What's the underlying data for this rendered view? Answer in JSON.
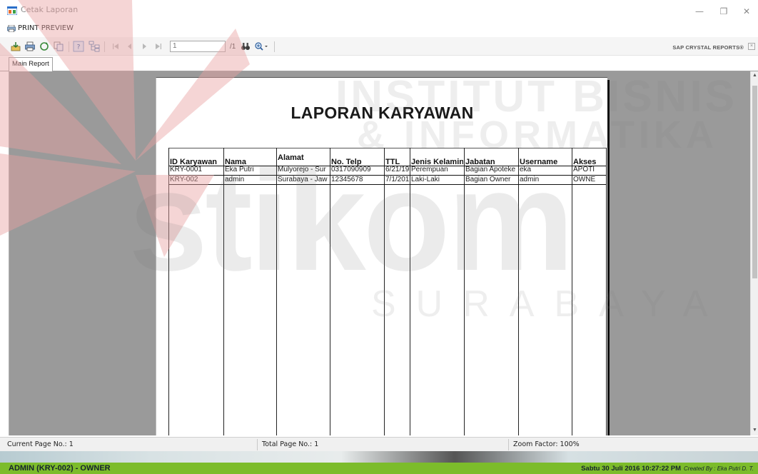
{
  "window": {
    "title": "Cetak Laporan",
    "minimize_glyph": "—",
    "maximize_glyph": "❐",
    "close_glyph": "✕"
  },
  "menu": {
    "print_preview_label": "PRINT PREVIEW"
  },
  "toolbar": {
    "page_input": "1",
    "page_total": "/1",
    "brand": "SAP CRYSTAL REPORTS®",
    "icons": [
      "export-icon",
      "print-icon",
      "refresh-icon",
      "copy-icon",
      "toggle-group-tree-icon",
      "group-tree-icon",
      "first-page-icon",
      "previous-page-icon",
      "next-page-icon",
      "last-page-icon",
      "find-icon",
      "zoom-icon"
    ]
  },
  "tabs": {
    "main_report": "Main Report"
  },
  "report": {
    "title": "LAPORAN KARYAWAN",
    "columns": [
      "ID Karyawan",
      "Nama",
      "Alamat",
      "No. Telp",
      "TTL",
      "Jenis Kelamin",
      "Jabatan",
      "Username",
      "Akses"
    ],
    "rows": [
      [
        "KRY-0001",
        "Eka Putri",
        "Mulyorejo - Sur",
        "0317090909",
        "6/21/19",
        "Perempuan",
        "Bagian Apoteke",
        "eka",
        "APOTI"
      ],
      [
        "KRY-002",
        "admin",
        "Surabaya - Jaw",
        "12345678",
        "7/1/201",
        "Laki-Laki",
        "Bagian Owner",
        "admin",
        "OWNE"
      ]
    ]
  },
  "watermark": {
    "line1": "INSTITUT BISNIS",
    "line2": "& INFORMATIKA",
    "line3": "stikom",
    "line4": "SURABAYA"
  },
  "status": {
    "current_page": "Current Page No.: 1",
    "total_page": "Total Page No.: 1",
    "zoom": "Zoom Factor: 100%"
  },
  "footer": {
    "user": "ADMIN (KRY-002) - OWNER",
    "datetime": "Sabtu  30 Juli 2016  10:27:22 PM",
    "credit": "Created By : Eka Putri D. T."
  },
  "colors": {
    "footer_bg": "#7cbc2b",
    "viewer_bg": "#9a9a9a",
    "watermark_red": "#e8a2a2"
  }
}
